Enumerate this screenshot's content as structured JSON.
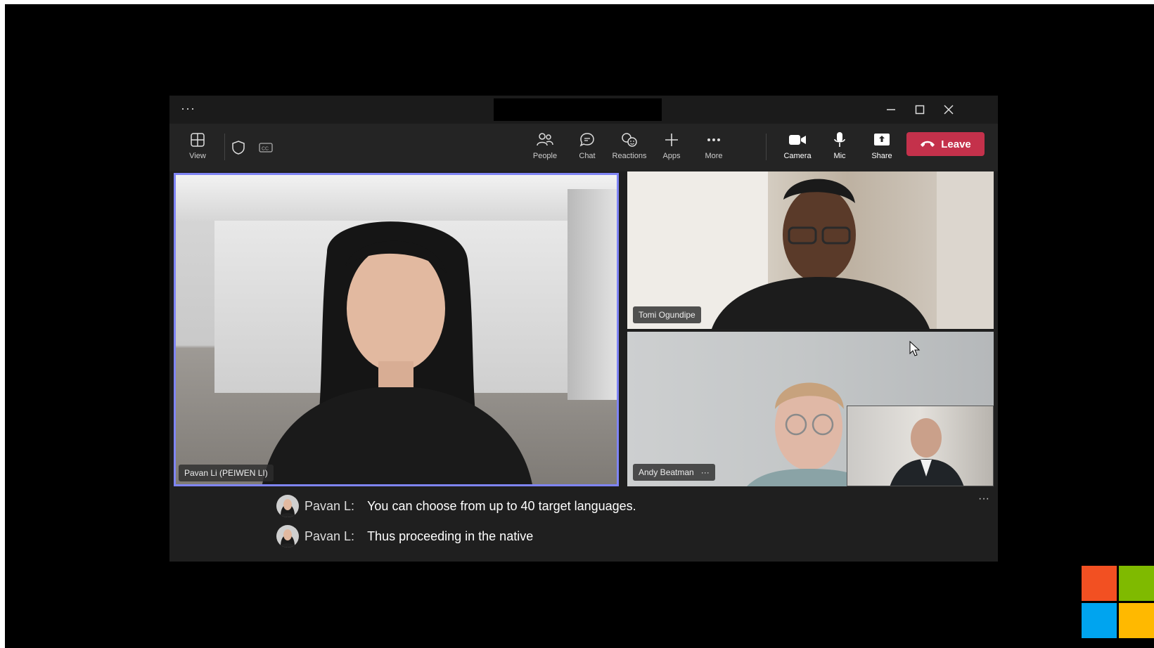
{
  "window": {
    "title_menu": "···",
    "controls": [
      "minimize",
      "maximize",
      "close"
    ]
  },
  "toolbar": {
    "view_label": "View",
    "people_label": "People",
    "chat_label": "Chat",
    "reactions_label": "Reactions",
    "apps_label": "Apps",
    "more_label": "More",
    "camera_label": "Camera",
    "mic_label": "Mic",
    "share_label": "Share",
    "leave_label": "Leave"
  },
  "participants": {
    "main_name": "Pavan Li (PEIWEN LI)",
    "tomi_name": "Tomi Ogundipe",
    "andy_name": "Andy Beatman",
    "andy_more": "···"
  },
  "captions": {
    "more": "···",
    "lines": [
      {
        "speaker": "Pavan L:",
        "text": "You can choose from up to 40 target languages."
      },
      {
        "speaker": "Pavan L:",
        "text": "Thus proceeding in the native"
      }
    ]
  },
  "colors": {
    "leave": "#c4314b",
    "active_border": "#7f85f5",
    "ms_red": "#f25022",
    "ms_green": "#7fba00",
    "ms_blue": "#00a4ef",
    "ms_yellow": "#ffb900"
  }
}
